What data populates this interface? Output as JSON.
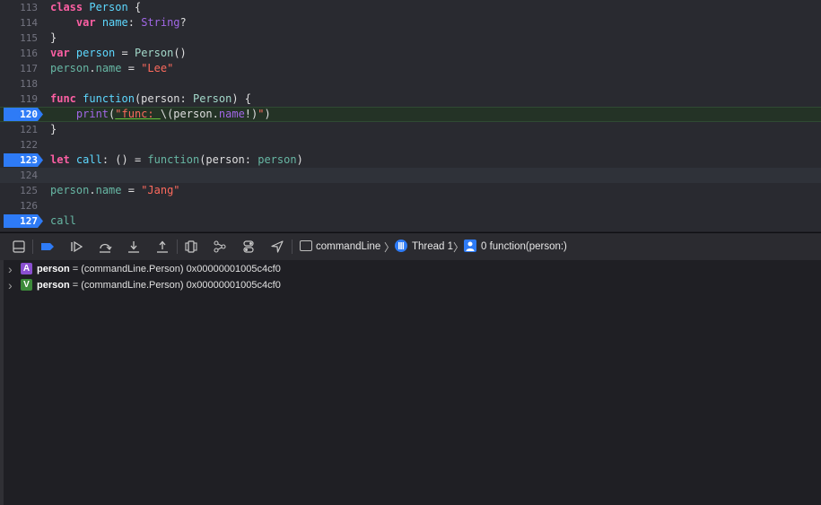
{
  "editor": {
    "lines": [
      {
        "num": "113",
        "breakpoint": false,
        "state": "",
        "tokens": [
          {
            "t": "class",
            "c": "kw"
          },
          {
            "t": " ",
            "c": "pl"
          },
          {
            "t": "Person",
            "c": "tp"
          },
          {
            "t": " {",
            "c": "pl"
          }
        ]
      },
      {
        "num": "114",
        "breakpoint": false,
        "state": "",
        "tokens": [
          {
            "t": "    ",
            "c": "pl"
          },
          {
            "t": "var",
            "c": "kw"
          },
          {
            "t": " ",
            "c": "pl"
          },
          {
            "t": "name",
            "c": "tp"
          },
          {
            "t": ": ",
            "c": "pl"
          },
          {
            "t": "String",
            "c": "pf"
          },
          {
            "t": "?",
            "c": "pl"
          }
        ]
      },
      {
        "num": "115",
        "breakpoint": false,
        "state": "",
        "tokens": [
          {
            "t": "}",
            "c": "pl"
          }
        ]
      },
      {
        "num": "116",
        "breakpoint": false,
        "state": "",
        "tokens": [
          {
            "t": "var",
            "c": "kw"
          },
          {
            "t": " ",
            "c": "pl"
          },
          {
            "t": "person",
            "c": "tp"
          },
          {
            "t": " = ",
            "c": "pl"
          },
          {
            "t": "Person",
            "c": "ty"
          },
          {
            "t": "()",
            "c": "pl"
          }
        ]
      },
      {
        "num": "117",
        "breakpoint": false,
        "state": "",
        "tokens": [
          {
            "t": "person",
            "c": "fn"
          },
          {
            "t": ".",
            "c": "pl"
          },
          {
            "t": "name",
            "c": "fn"
          },
          {
            "t": " = ",
            "c": "pl"
          },
          {
            "t": "\"Lee\"",
            "c": "str"
          }
        ]
      },
      {
        "num": "118",
        "breakpoint": false,
        "state": "",
        "tokens": []
      },
      {
        "num": "119",
        "breakpoint": false,
        "state": "",
        "tokens": [
          {
            "t": "func",
            "c": "kw"
          },
          {
            "t": " ",
            "c": "pl"
          },
          {
            "t": "function",
            "c": "tp"
          },
          {
            "t": "(person: ",
            "c": "pl"
          },
          {
            "t": "Person",
            "c": "ty"
          },
          {
            "t": ") {",
            "c": "pl"
          }
        ]
      },
      {
        "num": "120",
        "breakpoint": true,
        "state": "exec",
        "tokens": [
          {
            "t": "    ",
            "c": "pl"
          },
          {
            "t": "print",
            "c": "pf"
          },
          {
            "t": "(",
            "c": "pl"
          },
          {
            "t": "\"func: ",
            "c": "str uline"
          },
          {
            "t": "\\(",
            "c": "pl"
          },
          {
            "t": "person",
            "c": "pl"
          },
          {
            "t": ".",
            "c": "pl"
          },
          {
            "t": "name",
            "c": "pf"
          },
          {
            "t": "!)",
            "c": "pl"
          },
          {
            "t": "\"",
            "c": "str"
          },
          {
            "t": ")",
            "c": "pl"
          }
        ]
      },
      {
        "num": "121",
        "breakpoint": false,
        "state": "",
        "tokens": [
          {
            "t": "}",
            "c": "pl"
          }
        ]
      },
      {
        "num": "122",
        "breakpoint": false,
        "state": "",
        "tokens": []
      },
      {
        "num": "123",
        "breakpoint": true,
        "state": "",
        "tokens": [
          {
            "t": "let",
            "c": "kw"
          },
          {
            "t": " ",
            "c": "pl"
          },
          {
            "t": "call",
            "c": "tp"
          },
          {
            "t": ": () = ",
            "c": "pl"
          },
          {
            "t": "function",
            "c": "fn"
          },
          {
            "t": "(person: ",
            "c": "pl"
          },
          {
            "t": "person",
            "c": "fn"
          },
          {
            "t": ")",
            "c": "pl"
          }
        ]
      },
      {
        "num": "124",
        "breakpoint": false,
        "state": "current",
        "tokens": []
      },
      {
        "num": "125",
        "breakpoint": false,
        "state": "",
        "tokens": [
          {
            "t": "person",
            "c": "fn"
          },
          {
            "t": ".",
            "c": "pl"
          },
          {
            "t": "name",
            "c": "fn"
          },
          {
            "t": " = ",
            "c": "pl"
          },
          {
            "t": "\"Jang\"",
            "c": "str"
          }
        ]
      },
      {
        "num": "126",
        "breakpoint": false,
        "state": "",
        "tokens": []
      },
      {
        "num": "127",
        "breakpoint": true,
        "state": "",
        "tokens": [
          {
            "t": "call",
            "c": "fn"
          }
        ]
      }
    ]
  },
  "debugbar": {
    "buttons": [
      {
        "name": "hide-debug-area-button",
        "icon": "panel-bottom-icon",
        "active": false
      },
      {
        "name": "breakpoints-toggle-button",
        "icon": "breakpoint-icon",
        "active": true
      },
      {
        "name": "continue-button",
        "icon": "continue-icon",
        "active": false
      },
      {
        "name": "step-over-button",
        "icon": "step-over-icon",
        "active": false
      },
      {
        "name": "step-into-button",
        "icon": "step-into-icon",
        "active": false
      },
      {
        "name": "step-out-button",
        "icon": "step-out-icon",
        "active": false
      },
      {
        "name": "view-hierarchy-button",
        "icon": "view-hierarchy-icon",
        "active": false
      },
      {
        "name": "memory-graph-button",
        "icon": "memory-graph-icon",
        "active": false
      },
      {
        "name": "environment-overrides-button",
        "icon": "environment-overrides-icon",
        "active": false
      },
      {
        "name": "simulate-location-button",
        "icon": "location-icon",
        "active": false
      }
    ],
    "breadcrumb": {
      "process": "commandLine",
      "thread": "Thread 1",
      "frame": "0 function(person:)"
    }
  },
  "variables": [
    {
      "badge": "A",
      "badge_color": "#8a4fd0",
      "name": "person",
      "value": " = (commandLine.Person) 0x00000001005c4cf0"
    },
    {
      "badge": "V",
      "badge_color": "#3c8a3a",
      "name": "person",
      "value": " = (commandLine.Person) 0x00000001005c4cf0"
    }
  ],
  "colors": {
    "accent": "#2e7bf6",
    "exec_line": "#243326",
    "editor_bg": "#292a30",
    "debug_bg": "#1f1f24"
  }
}
